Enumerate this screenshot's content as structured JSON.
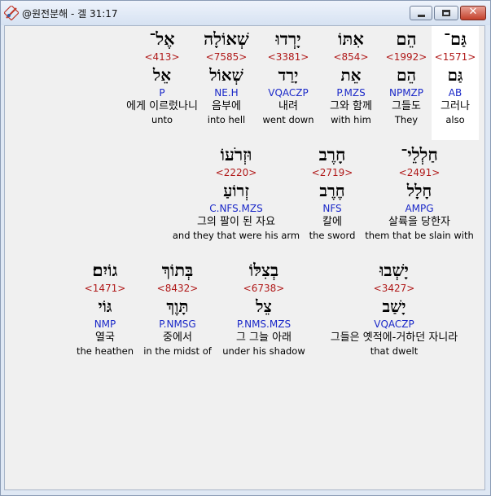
{
  "window": {
    "title": "@원전분해 - 겔 31:17",
    "controls": {
      "minimize": "minimize",
      "maximize": "maximize",
      "close": "✕"
    }
  },
  "rows": [
    {
      "words": [
        {
          "hebrew": "אֶל־",
          "strong": "<413>",
          "lemma": "אֵל",
          "parse": "P",
          "korean": "에게 이르렀나니",
          "english": "unto"
        },
        {
          "hebrew": "שְׁאוֹלָה",
          "strong": "<7585>",
          "lemma": "שְׁאוֹל",
          "parse": "NE.H",
          "korean": "음부에",
          "english": "into hell"
        },
        {
          "hebrew": "יָרְדוּ",
          "strong": "<3381>",
          "lemma": "יָרַד",
          "parse": "VQACZP",
          "korean": "내려",
          "english": "went down"
        },
        {
          "hebrew": "אִתּוֹ",
          "strong": "<854>",
          "lemma": "אֵת",
          "parse": "P.MZS",
          "korean": "그와 함께",
          "english": "with him"
        },
        {
          "hebrew": "הֵם",
          "strong": "<1992>",
          "lemma": "הֵם",
          "parse": "NPMZP",
          "korean": "그들도",
          "english": "They"
        },
        {
          "hebrew": "גַּם־",
          "strong": "<1571>",
          "lemma": "גַּם",
          "parse": "AB",
          "korean": "그러나",
          "english": "also"
        }
      ]
    },
    {
      "words": [
        {
          "hebrew": "וּזְרֹעוֹ",
          "strong": "<2220>",
          "lemma": "זְרוֹעַ",
          "parse": "C.NFS.MZS",
          "korean": "그의 팔이 된 자요",
          "english": "and they that were his arm"
        },
        {
          "hebrew": "חָרֶב",
          "strong": "<2719>",
          "lemma": "חֶרֶב",
          "parse": "NFS",
          "korean": "칼에",
          "english": "the sword"
        },
        {
          "hebrew": "חַלְלֵי־",
          "strong": "<2491>",
          "lemma": "חָלָל",
          "parse": "AMPG",
          "korean": "살륙을 당한자",
          "english": "them that be slain with"
        }
      ]
    },
    {
      "words": [
        {
          "hebrew": "גוֹיִם׃",
          "strong": "<1471>",
          "lemma": "גּוֹי",
          "parse": "NMP",
          "korean": "열국",
          "english": "the heathen"
        },
        {
          "hebrew": "בְּתוֹךְ",
          "strong": "<8432>",
          "lemma": "תָּוֶךְ",
          "parse": "P.NMSG",
          "korean": "중에서",
          "english": "in the midst of"
        },
        {
          "hebrew": "בְצִלּוֹ",
          "strong": "<6738>",
          "lemma": "צֵל",
          "parse": "P.NMS.MZS",
          "korean": "그 그늘 아래",
          "english": "under his shadow"
        },
        {
          "hebrew": "יָשְׁבוּ",
          "strong": "<3427>",
          "lemma": "יָשַׁב",
          "parse": "VQACZP",
          "korean": "그들은 옛적에-거하던 자니라",
          "english": "that dwelt"
        }
      ]
    }
  ]
}
